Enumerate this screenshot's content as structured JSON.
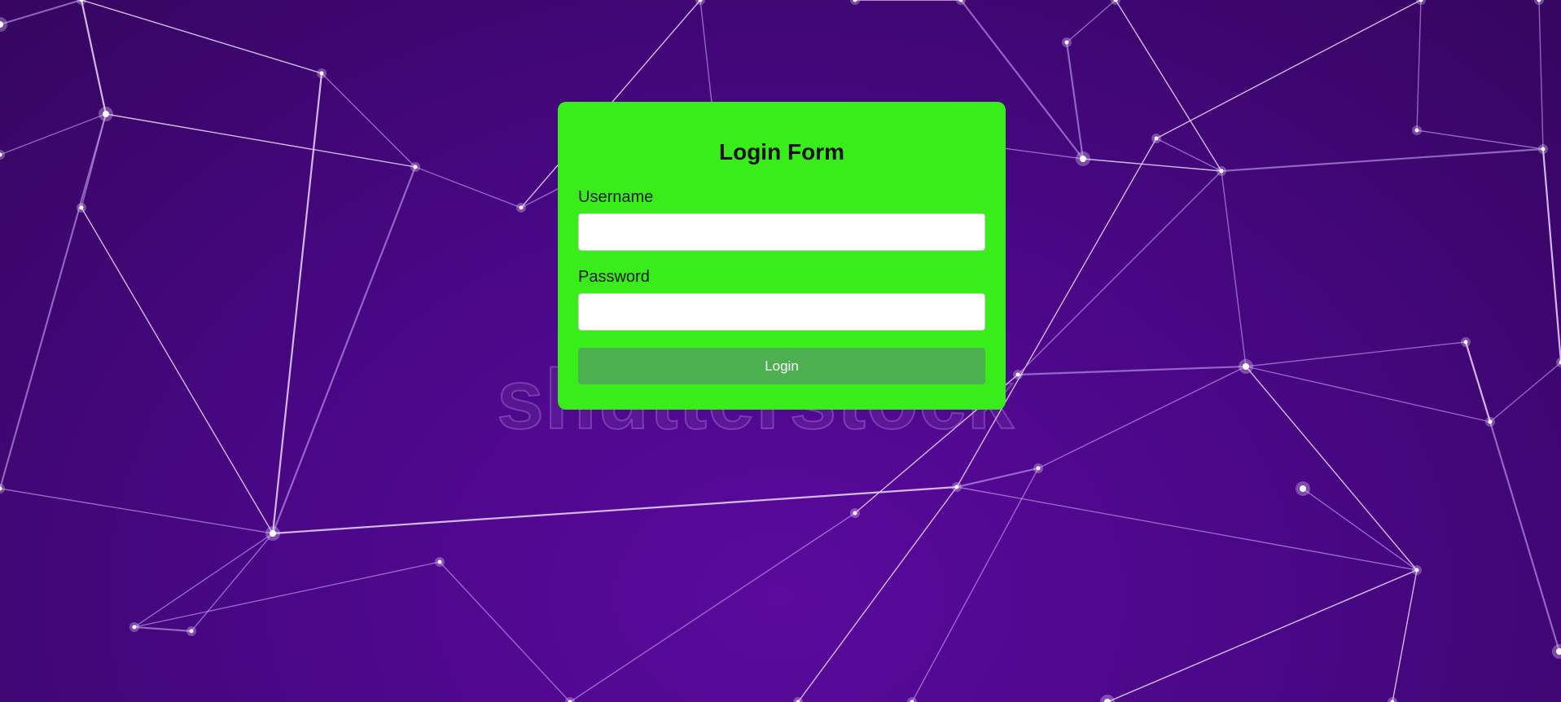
{
  "page": {
    "background_color": "#4a0787",
    "watermark_text": "shutterstock"
  },
  "login_form": {
    "title": "Login Form",
    "card_color": "#39ed1a",
    "username": {
      "label": "Username",
      "value": "",
      "placeholder": ""
    },
    "password": {
      "label": "Password",
      "value": "",
      "placeholder": ""
    },
    "submit": {
      "label": "Login",
      "color": "#4caf50"
    }
  }
}
